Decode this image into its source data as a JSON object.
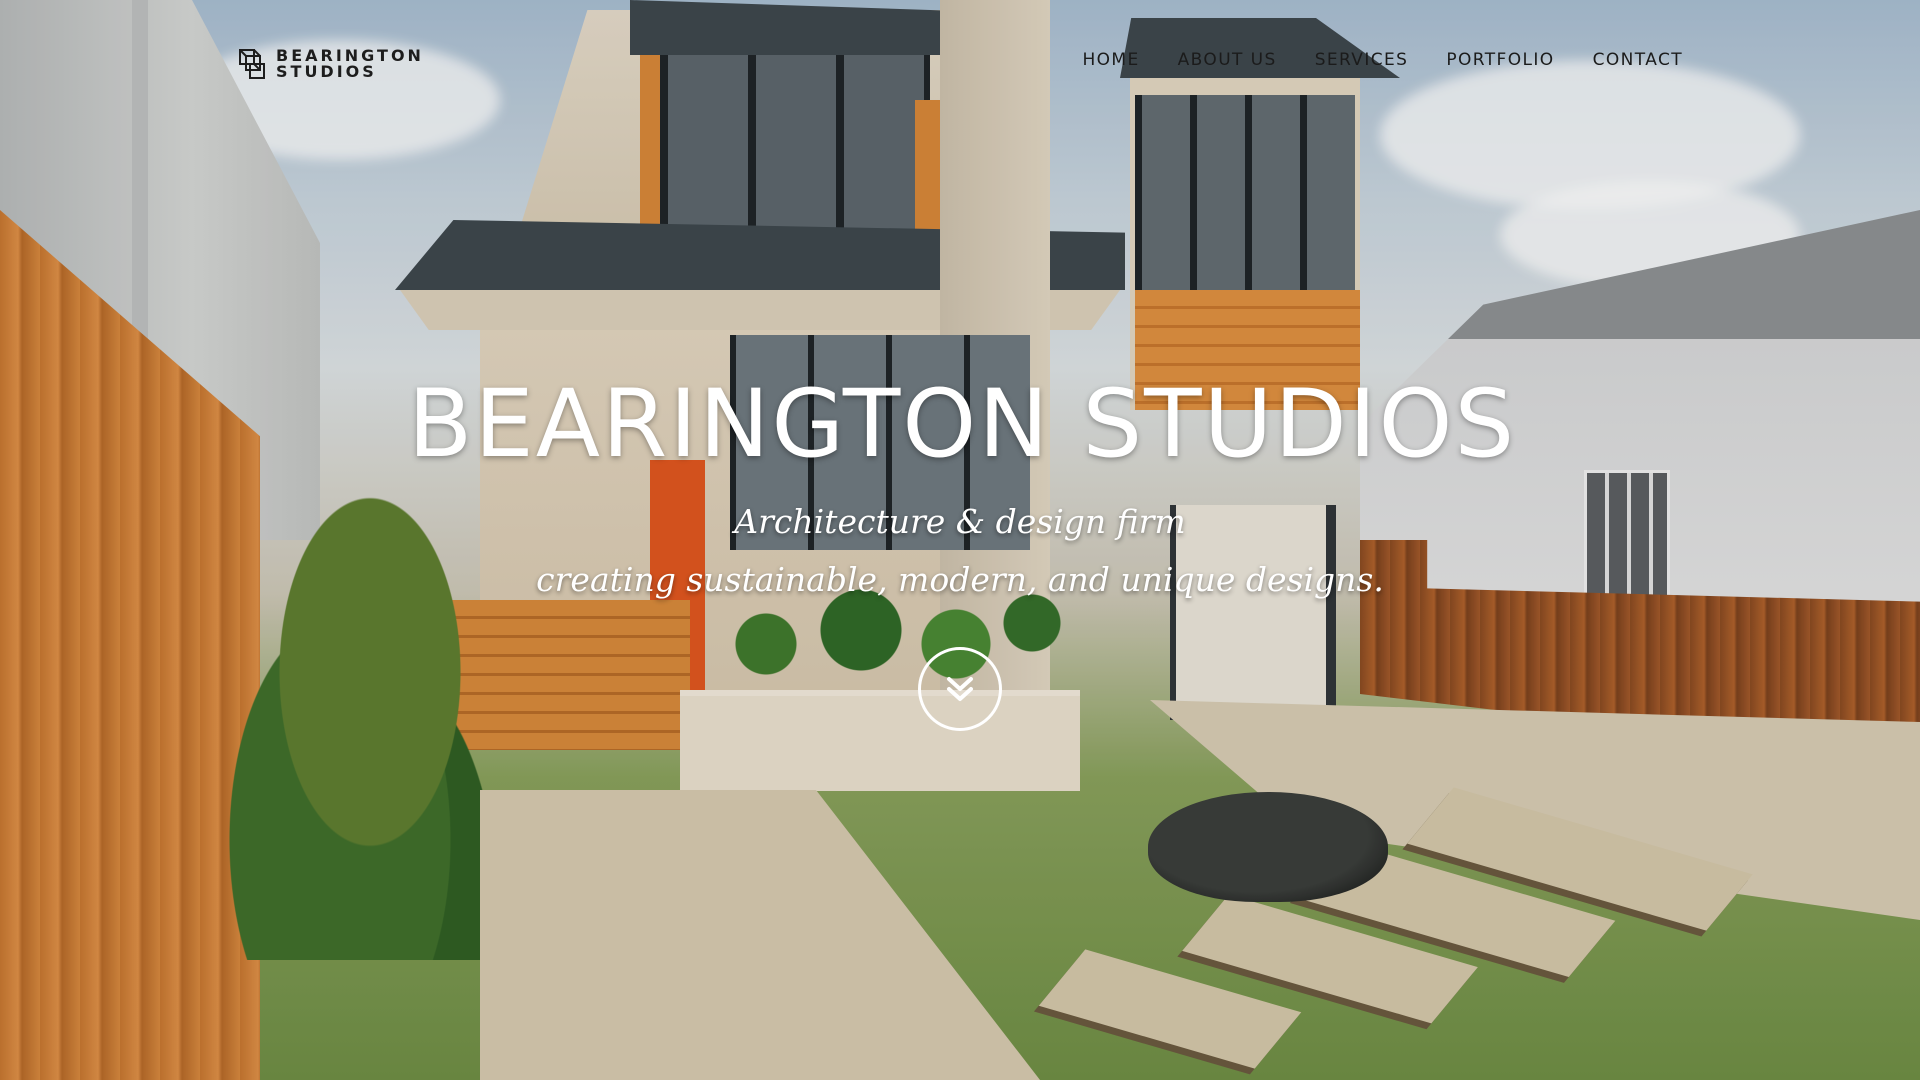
{
  "site": {
    "logo_line1": "BEARINGTON",
    "logo_line2": "STUDIOS",
    "logo_icon": "cube-logo-icon"
  },
  "nav": {
    "items": [
      {
        "label": "HOME"
      },
      {
        "label": "ABOUT US"
      },
      {
        "label": "SERVICES"
      },
      {
        "label": "PORTFOLIO"
      },
      {
        "label": "CONTACT"
      }
    ]
  },
  "hero": {
    "title": "BEARINGTON STUDIOS",
    "subtitle_line1": "Architecture & design firm",
    "subtitle_line2": "creating sustainable, modern, and unique designs.",
    "scroll_icon": "double-chevron-down-icon"
  },
  "colors": {
    "nav_text": "#1b1b1b",
    "hero_text": "#ffffff",
    "accent_orange": "#e2561e"
  }
}
